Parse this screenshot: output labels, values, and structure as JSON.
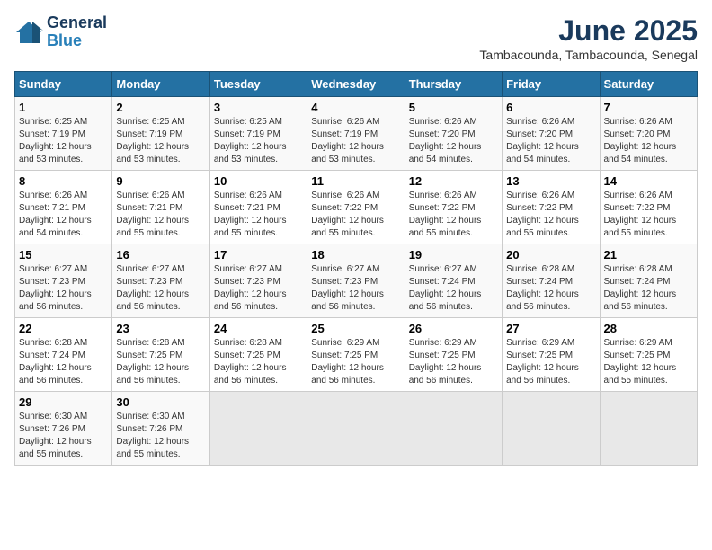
{
  "logo": {
    "line1": "General",
    "line2": "Blue"
  },
  "title": "June 2025",
  "subtitle": "Tambacounda, Tambacounda, Senegal",
  "weekdays": [
    "Sunday",
    "Monday",
    "Tuesday",
    "Wednesday",
    "Thursday",
    "Friday",
    "Saturday"
  ],
  "weeks": [
    [
      {
        "day": "1",
        "sunrise": "6:25 AM",
        "sunset": "7:19 PM",
        "daylight": "12 hours and 53 minutes."
      },
      {
        "day": "2",
        "sunrise": "6:25 AM",
        "sunset": "7:19 PM",
        "daylight": "12 hours and 53 minutes."
      },
      {
        "day": "3",
        "sunrise": "6:25 AM",
        "sunset": "7:19 PM",
        "daylight": "12 hours and 53 minutes."
      },
      {
        "day": "4",
        "sunrise": "6:26 AM",
        "sunset": "7:19 PM",
        "daylight": "12 hours and 53 minutes."
      },
      {
        "day": "5",
        "sunrise": "6:26 AM",
        "sunset": "7:20 PM",
        "daylight": "12 hours and 54 minutes."
      },
      {
        "day": "6",
        "sunrise": "6:26 AM",
        "sunset": "7:20 PM",
        "daylight": "12 hours and 54 minutes."
      },
      {
        "day": "7",
        "sunrise": "6:26 AM",
        "sunset": "7:20 PM",
        "daylight": "12 hours and 54 minutes."
      }
    ],
    [
      {
        "day": "8",
        "sunrise": "6:26 AM",
        "sunset": "7:21 PM",
        "daylight": "12 hours and 54 minutes."
      },
      {
        "day": "9",
        "sunrise": "6:26 AM",
        "sunset": "7:21 PM",
        "daylight": "12 hours and 55 minutes."
      },
      {
        "day": "10",
        "sunrise": "6:26 AM",
        "sunset": "7:21 PM",
        "daylight": "12 hours and 55 minutes."
      },
      {
        "day": "11",
        "sunrise": "6:26 AM",
        "sunset": "7:22 PM",
        "daylight": "12 hours and 55 minutes."
      },
      {
        "day": "12",
        "sunrise": "6:26 AM",
        "sunset": "7:22 PM",
        "daylight": "12 hours and 55 minutes."
      },
      {
        "day": "13",
        "sunrise": "6:26 AM",
        "sunset": "7:22 PM",
        "daylight": "12 hours and 55 minutes."
      },
      {
        "day": "14",
        "sunrise": "6:26 AM",
        "sunset": "7:22 PM",
        "daylight": "12 hours and 55 minutes."
      }
    ],
    [
      {
        "day": "15",
        "sunrise": "6:27 AM",
        "sunset": "7:23 PM",
        "daylight": "12 hours and 56 minutes."
      },
      {
        "day": "16",
        "sunrise": "6:27 AM",
        "sunset": "7:23 PM",
        "daylight": "12 hours and 56 minutes."
      },
      {
        "day": "17",
        "sunrise": "6:27 AM",
        "sunset": "7:23 PM",
        "daylight": "12 hours and 56 minutes."
      },
      {
        "day": "18",
        "sunrise": "6:27 AM",
        "sunset": "7:23 PM",
        "daylight": "12 hours and 56 minutes."
      },
      {
        "day": "19",
        "sunrise": "6:27 AM",
        "sunset": "7:24 PM",
        "daylight": "12 hours and 56 minutes."
      },
      {
        "day": "20",
        "sunrise": "6:28 AM",
        "sunset": "7:24 PM",
        "daylight": "12 hours and 56 minutes."
      },
      {
        "day": "21",
        "sunrise": "6:28 AM",
        "sunset": "7:24 PM",
        "daylight": "12 hours and 56 minutes."
      }
    ],
    [
      {
        "day": "22",
        "sunrise": "6:28 AM",
        "sunset": "7:24 PM",
        "daylight": "12 hours and 56 minutes."
      },
      {
        "day": "23",
        "sunrise": "6:28 AM",
        "sunset": "7:25 PM",
        "daylight": "12 hours and 56 minutes."
      },
      {
        "day": "24",
        "sunrise": "6:28 AM",
        "sunset": "7:25 PM",
        "daylight": "12 hours and 56 minutes."
      },
      {
        "day": "25",
        "sunrise": "6:29 AM",
        "sunset": "7:25 PM",
        "daylight": "12 hours and 56 minutes."
      },
      {
        "day": "26",
        "sunrise": "6:29 AM",
        "sunset": "7:25 PM",
        "daylight": "12 hours and 56 minutes."
      },
      {
        "day": "27",
        "sunrise": "6:29 AM",
        "sunset": "7:25 PM",
        "daylight": "12 hours and 56 minutes."
      },
      {
        "day": "28",
        "sunrise": "6:29 AM",
        "sunset": "7:25 PM",
        "daylight": "12 hours and 55 minutes."
      }
    ],
    [
      {
        "day": "29",
        "sunrise": "6:30 AM",
        "sunset": "7:26 PM",
        "daylight": "12 hours and 55 minutes."
      },
      {
        "day": "30",
        "sunrise": "6:30 AM",
        "sunset": "7:26 PM",
        "daylight": "12 hours and 55 minutes."
      },
      null,
      null,
      null,
      null,
      null
    ]
  ]
}
